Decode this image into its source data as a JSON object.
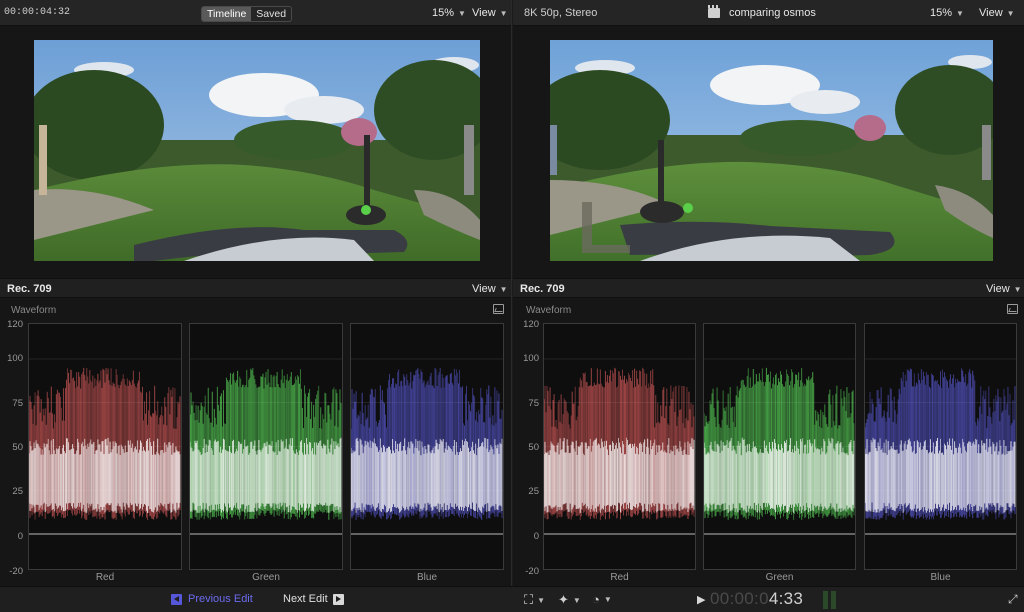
{
  "left": {
    "timecode": "00:00:04:32",
    "segment": [
      "Timeline",
      "Saved"
    ],
    "zoom": "15%",
    "view": "View"
  },
  "right": {
    "format": "8K 50p, Stereo",
    "project_name": "comparing osmos",
    "zoom": "15%",
    "view": "View"
  },
  "scopes_left": {
    "colorspace": "Rec. 709",
    "view": "View",
    "title": "Waveform",
    "y_ticks": [
      "120",
      "100",
      "75",
      "50",
      "25",
      "0",
      "-20"
    ],
    "channels": [
      "Red",
      "Green",
      "Blue"
    ]
  },
  "scopes_right": {
    "colorspace": "Rec. 709",
    "view": "View",
    "title": "Waveform",
    "y_ticks": [
      "120",
      "100",
      "75",
      "50",
      "25",
      "0",
      "-20"
    ],
    "channels": [
      "Red",
      "Green",
      "Blue"
    ]
  },
  "bottom": {
    "previous_edit": "Previous Edit",
    "next_edit": "Next Edit",
    "timecode_dim": "00:00:0",
    "timecode_lit": "4:33"
  },
  "colors": {
    "red": "#ff6a6a",
    "green": "#6aff6a",
    "blue": "#6a6aff",
    "accent": "#6b6bf0"
  },
  "icons": [
    "clapper-icon",
    "waveform-settings-icon",
    "previous-edit-icon",
    "next-edit-icon",
    "crop-tool-icon",
    "magic-wand-icon",
    "speed-icon",
    "play-icon",
    "fullscreen-icon"
  ]
}
